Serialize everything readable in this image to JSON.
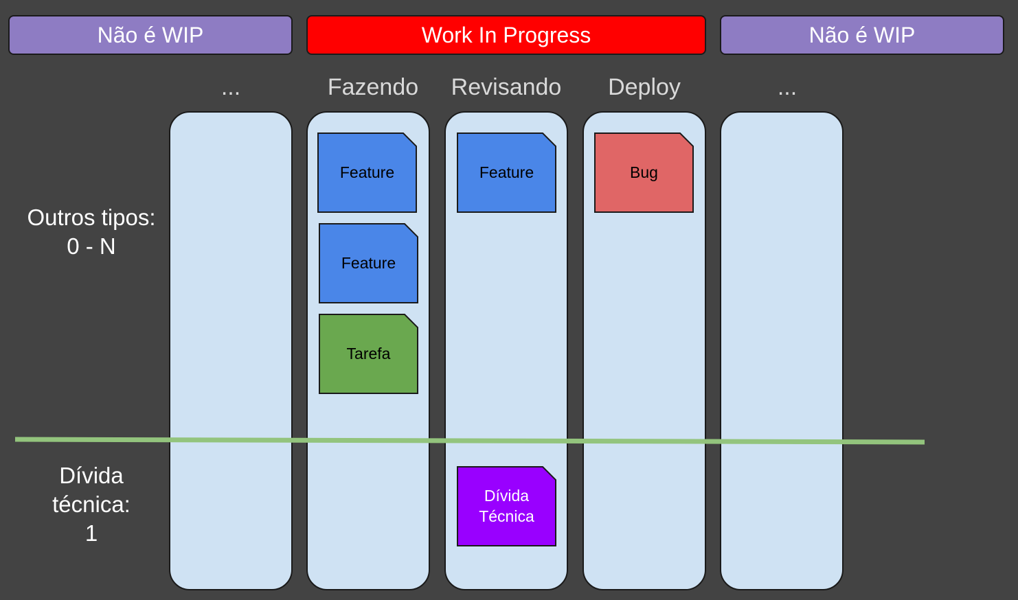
{
  "banners": [
    {
      "label": "Não é WIP",
      "color": "#8e7cc3"
    },
    {
      "label": "Work In Progress",
      "color": "#ff0000"
    },
    {
      "label": "Não é WIP",
      "color": "#8e7cc3"
    }
  ],
  "columns": [
    {
      "header": "..."
    },
    {
      "header": "Fazendo"
    },
    {
      "header": "Revisando"
    },
    {
      "header": "Deploy"
    },
    {
      "header": "..."
    }
  ],
  "cards": {
    "fazendo_1": {
      "label": "Feature",
      "color": "#4a86e8",
      "text_color": "#000000"
    },
    "fazendo_2": {
      "label": "Feature",
      "color": "#4a86e8",
      "text_color": "#000000"
    },
    "fazendo_3": {
      "label": "Tarefa",
      "color": "#6aa84f",
      "text_color": "#000000"
    },
    "revisando_1": {
      "label": "Feature",
      "color": "#4a86e8",
      "text_color": "#000000"
    },
    "deploy_1": {
      "label": "Bug",
      "color": "#e06666",
      "text_color": "#000000"
    },
    "revisando_2": {
      "label_line1": "Dívida",
      "label_line2": "Técnica",
      "color": "#9900ff",
      "text_color": "#ffffff"
    }
  },
  "lanes": {
    "other": {
      "line1": "Outros tipos:",
      "line2": "0 - N"
    },
    "debt": {
      "line1": "Dívida",
      "line2": "técnica:",
      "line3": "1"
    }
  },
  "divider_color": "#93c47d"
}
